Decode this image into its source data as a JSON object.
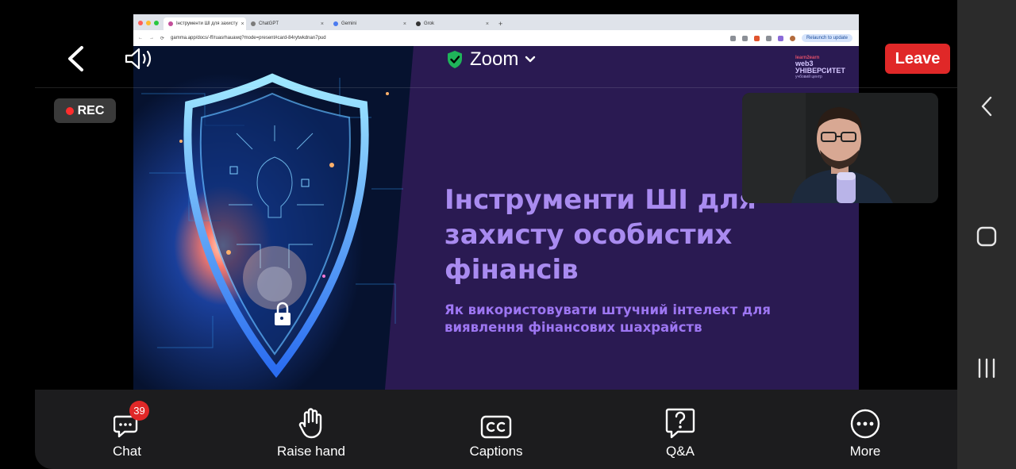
{
  "topbar": {
    "meeting_title": "Zoom",
    "leave_label": "Leave",
    "rec_label": "REC"
  },
  "browser": {
    "tabs": [
      {
        "label": "Інструменти ШІ для захисту"
      },
      {
        "label": "ChatGPT"
      },
      {
        "label": "Gemini"
      },
      {
        "label": "Grok"
      }
    ],
    "url": "gamma.app/docs/-ff/ruasrhauawq?mode=present#card-84rytwkdnan7pud",
    "relaunch_label": "Relaunch to update"
  },
  "slide": {
    "title_lines": [
      "Інструменти ШІ для",
      "захисту особистих",
      "фінансів"
    ],
    "subtitle_lines": [
      "Як використовувати штучний інтелект для",
      "виявлення фінансових шахрайств"
    ],
    "logo": {
      "top": "learn2earn",
      "main": "web3",
      "main2": "УНІВЕРСИТЕТ",
      "sub": "учбовий центр"
    }
  },
  "toolbar": {
    "chat_label": "Chat",
    "chat_badge": "39",
    "raise_hand_label": "Raise hand",
    "captions_label": "Captions",
    "qa_label": "Q&A",
    "more_label": "More"
  },
  "colors": {
    "leave": "#e02828",
    "slide_bg": "#2a1a52",
    "slide_title": "#a98bf0",
    "shield_check": "#1fb45a",
    "toolbar_bg": "#1c1c1e"
  },
  "icons": [
    "back-arrow-icon",
    "speaker-icon",
    "shield-check-icon",
    "chevron-down-icon",
    "rec-dot-icon",
    "chat-icon",
    "hand-icon",
    "cc-icon",
    "question-icon",
    "more-icon",
    "android-back-icon",
    "android-home-icon",
    "android-recents-icon"
  ]
}
